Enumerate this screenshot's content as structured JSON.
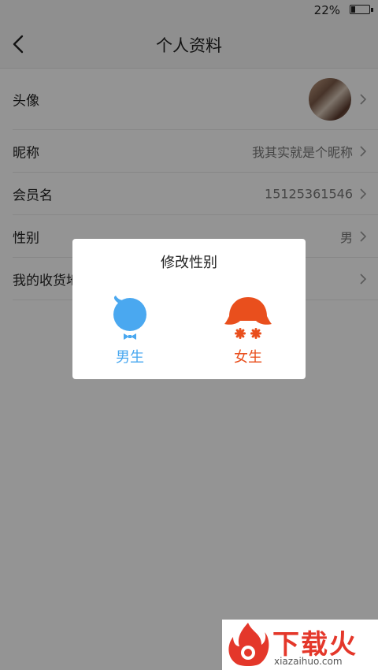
{
  "status_bar": {
    "battery_text": "22%"
  },
  "nav": {
    "title": "个人资料"
  },
  "rows": [
    {
      "label": "头像",
      "value": ""
    },
    {
      "label": "昵称",
      "value": "我其实就是个昵称"
    },
    {
      "label": "会员名",
      "value": "15125361546"
    },
    {
      "label": "性别",
      "value": "男"
    },
    {
      "label": "我的收货地址",
      "value": ""
    }
  ],
  "dialog": {
    "title": "修改性别",
    "male_label": "男生",
    "female_label": "女生"
  },
  "colors": {
    "male": "#4aa8f0",
    "female": "#e94f1d",
    "watermark": "#e4372a"
  },
  "watermark": {
    "title": "下载火",
    "domain": "xiazaihuo.com"
  }
}
